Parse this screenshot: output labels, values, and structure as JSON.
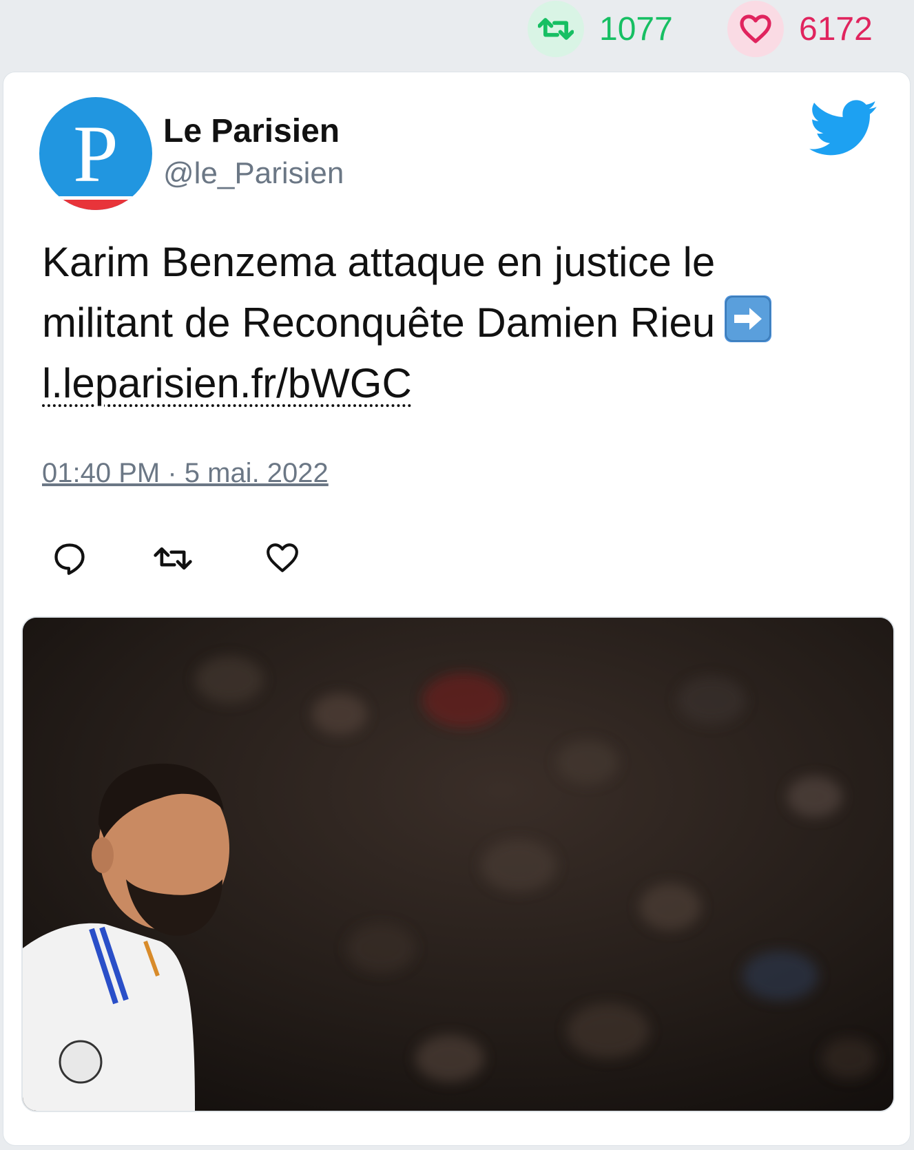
{
  "stats": {
    "retweets": "1077",
    "likes": "6172",
    "retweet_color": "#17bf63",
    "like_color": "#e0245e"
  },
  "tweet": {
    "author_name": "Le Parisien",
    "author_handle": "@le_Parisien",
    "avatar_letter": "P",
    "text_line1": "Karim Benzema attaque en justice le",
    "text_line2": "militant de Reconquête Damien Rieu",
    "link": "l.leparisien.fr/bWGC",
    "timestamp": "01:40 PM · 5 mai. 2022"
  },
  "icons": {
    "retweet": "retweet-icon",
    "like": "heart-icon",
    "reply": "reply-icon",
    "brand": "twitter-bird-icon",
    "emoji": "right-arrow-emoji"
  },
  "colors": {
    "twitter_blue": "#1da1f2",
    "avatar_blue": "#2196e0",
    "avatar_red": "#e8343a"
  }
}
